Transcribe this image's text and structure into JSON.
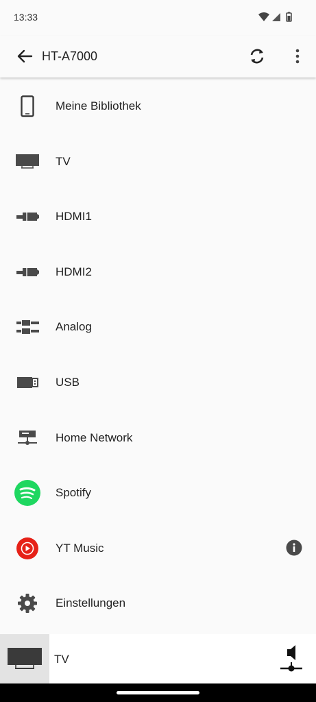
{
  "status_bar": {
    "time": "13:33",
    "icons": [
      "wifi-icon",
      "cell-signal-icon",
      "battery-icon"
    ]
  },
  "app_bar": {
    "title": "HT-A7000",
    "back_icon": "arrow-back-icon",
    "refresh_icon": "refresh-icon",
    "more_icon": "more-vert-icon"
  },
  "sources": [
    {
      "label": "Meine Bibliothek",
      "icon": "phone-icon"
    },
    {
      "label": "TV",
      "icon": "tv-icon"
    },
    {
      "label": "HDMI1",
      "icon": "hdmi-icon"
    },
    {
      "label": "HDMI2",
      "icon": "hdmi-icon"
    },
    {
      "label": "Analog",
      "icon": "analog-cable-icon"
    },
    {
      "label": "USB",
      "icon": "usb-icon"
    },
    {
      "label": "Home Network",
      "icon": "home-network-icon"
    },
    {
      "label": "Spotify",
      "icon": "spotify-icon"
    },
    {
      "label": "YT Music",
      "icon": "yt-music-icon"
    },
    {
      "label": "Einstellungen",
      "icon": "settings-gear-icon"
    }
  ],
  "now_playing": {
    "label": "TV",
    "icon": "tv-icon",
    "volume_icon": "volume-slider-icon"
  },
  "colors": {
    "background": "#fafafa",
    "icon_gray": "#4a4a4a",
    "spotify_green": "#1ed760",
    "yt_red": "#e62117"
  }
}
